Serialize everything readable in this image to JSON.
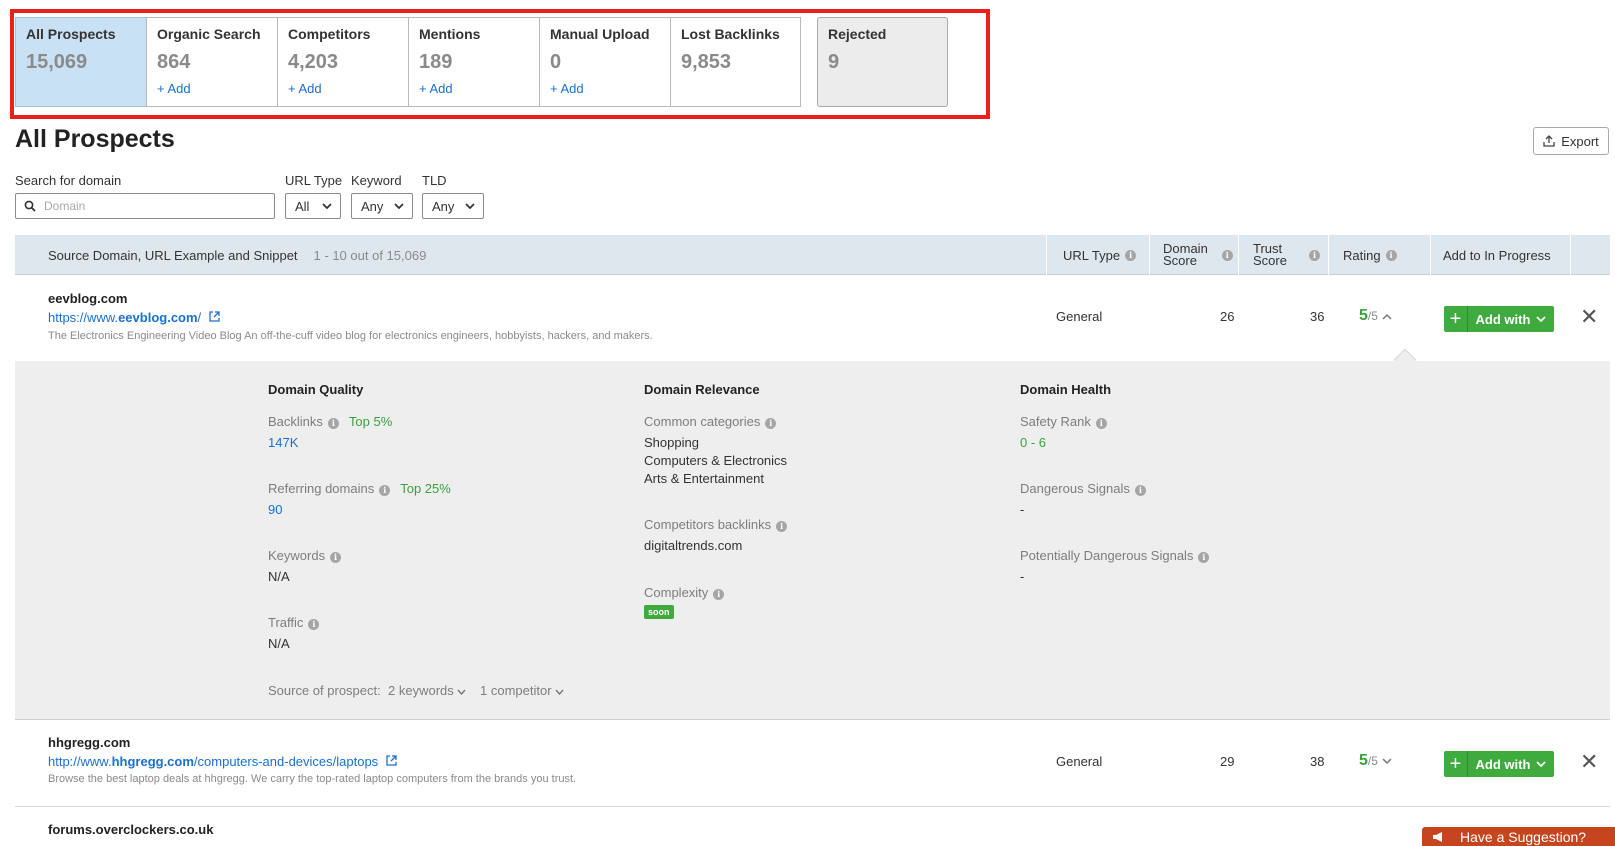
{
  "tabs": [
    {
      "label": "All Prospects",
      "count": "15,069",
      "add": ""
    },
    {
      "label": "Organic Search",
      "count": "864",
      "add": "+ Add"
    },
    {
      "label": "Competitors",
      "count": "4,203",
      "add": "+ Add"
    },
    {
      "label": "Mentions",
      "count": "189",
      "add": "+ Add"
    },
    {
      "label": "Manual Upload",
      "count": "0",
      "add": "+ Add"
    },
    {
      "label": "Lost Backlinks",
      "count": "9,853",
      "add": ""
    },
    {
      "label": "Rejected",
      "count": "9",
      "add": ""
    }
  ],
  "page": {
    "title": "All Prospects",
    "export_label": "Export"
  },
  "filters": {
    "search_label": "Search for domain",
    "search_placeholder": "Domain",
    "url_type_label": "URL Type",
    "url_type_value": "All",
    "keyword_label": "Keyword",
    "keyword_value": "Any",
    "tld_label": "TLD",
    "tld_value": "Any"
  },
  "table": {
    "header_source": "Source Domain, URL Example and Snippet",
    "header_range": "1 - 10 out of 15,069",
    "header_url_type": "URL Type",
    "header_domain_score_1": "Domain",
    "header_domain_score_2": "Score",
    "header_trust_score_1": "Trust",
    "header_trust_score_2": "Score",
    "header_rating": "Rating",
    "header_add": "Add to In Progress",
    "add_with_label": "Add with",
    "rows": [
      {
        "domain": "eevblog.com",
        "url_prefix": "https://www.",
        "url_bold": "eevblog.com",
        "url_suffix": "/",
        "snippet": "The Electronics Engineering Video Blog An off-the-cuff video blog for electronics engineers, hobbyists, hackers, and makers.",
        "url_type": "General",
        "domain_score": "26",
        "trust_score": "36",
        "rating": "5",
        "rating_of": "/5"
      },
      {
        "domain": "hhgregg.com",
        "url_prefix": "http://www.",
        "url_bold": "hhgregg.com",
        "url_suffix": "/computers-and-devices/laptops",
        "snippet": "Browse the best laptop deals at hhgregg. We carry the top-rated laptop computers from the brands you trust.",
        "url_type": "General",
        "domain_score": "29",
        "trust_score": "38",
        "rating": "5",
        "rating_of": "/5"
      },
      {
        "domain": "forums.overclockers.co.uk"
      }
    ]
  },
  "details": {
    "quality_title": "Domain Quality",
    "backlinks_label": "Backlinks",
    "backlinks_badge": "Top 5%",
    "backlinks_value": "147K",
    "refdomains_label": "Referring domains",
    "refdomains_badge": "Top 25%",
    "refdomains_value": "90",
    "keywords_label": "Keywords",
    "keywords_value": "N/A",
    "traffic_label": "Traffic",
    "traffic_value": "N/A",
    "source_label": "Source of prospect:",
    "source_keywords": "2 keywords",
    "source_competitor": "1 competitor",
    "relevance_title": "Domain Relevance",
    "categories_label": "Common categories",
    "categories": [
      "Shopping",
      "Computers & Electronics",
      "Arts & Entertainment"
    ],
    "comp_backlinks_label": "Competitors backlinks",
    "comp_backlinks_value": "digitaltrends.com",
    "complexity_label": "Complexity",
    "complexity_badge": "soon",
    "health_title": "Domain Health",
    "safety_label": "Safety Rank",
    "safety_value": "0 - 6",
    "dangerous_label": "Dangerous Signals",
    "dangerous_value": "-",
    "pot_dangerous_label": "Potentially Dangerous Signals",
    "pot_dangerous_value": "-"
  },
  "suggestion": {
    "label": "Have a Suggestion?"
  },
  "colors": {
    "accent_blue": "#1b6fd0",
    "green": "#3fab3e",
    "highlight_red": "#e8211b",
    "active_tab": "#c9e1f5"
  }
}
